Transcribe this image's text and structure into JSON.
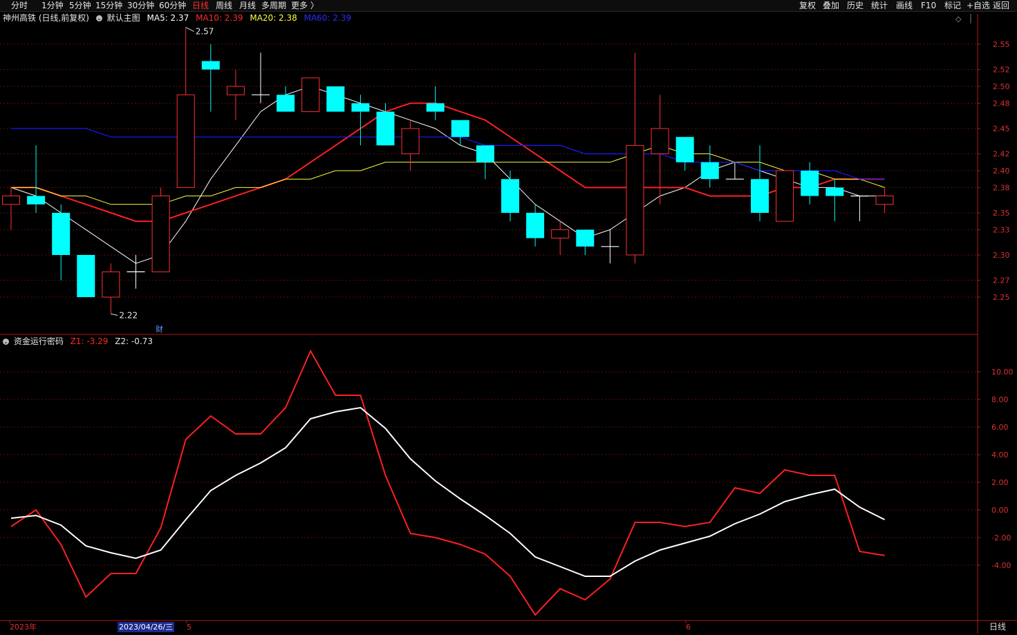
{
  "toolbar": {
    "periods": [
      "分时",
      "1分钟",
      "5分钟",
      "15分钟",
      "30分钟",
      "60分钟",
      "日线",
      "周线",
      "月线",
      "多周期",
      "更多 〉"
    ],
    "active_period": "日线",
    "right_tools": [
      "复权",
      "叠加",
      "历史",
      "统计",
      "画线",
      "F10",
      "标记",
      "+自选",
      "返回"
    ]
  },
  "main_chart": {
    "stock_title": "神州高铁 (日线,前复权)",
    "template": "默认主图",
    "ma5_label": "MA5: 2.37",
    "ma10_label": "MA10: 2.39",
    "ma20_label": "MA20: 2.38",
    "ma60_label": "MA60: 2.39",
    "high_label": "2.57",
    "low_label": "2.22",
    "finance_mark": "财",
    "y_ticks": [
      "2.55",
      "2.52",
      "2.50",
      "2.48",
      "2.45",
      "2.42",
      "2.40",
      "2.38",
      "2.35",
      "2.33",
      "2.30",
      "2.27",
      "2.25"
    ]
  },
  "sub_chart": {
    "indicator": "资金运行密码",
    "z1_label": "Z1: -3.29",
    "z2_label": "Z2: -0.73",
    "y_ticks": [
      "10.00",
      "8.00",
      "6.00",
      "4.00",
      "2.00",
      "0.00",
      "-2.00",
      "-4.00"
    ]
  },
  "axis": {
    "year": "2023年",
    "cursor_date": "2023/04/26/三",
    "month5": "5",
    "month6": "6",
    "period_button": "日线"
  },
  "colors": {
    "up": "#ff3030",
    "down": "#00ffff",
    "ma5": "#ffffff",
    "ma10": "#ff2020",
    "ma20": "#ffff40",
    "ma60": "#1a1aff"
  },
  "chart_data": [
    {
      "type": "candlestick",
      "title": "神州高铁 (日线,前复权)",
      "ylim": [
        2.22,
        2.57
      ],
      "candles": [
        {
          "o": 2.36,
          "h": 2.38,
          "l": 2.33,
          "c": 2.37,
          "color": "up"
        },
        {
          "o": 2.37,
          "h": 2.43,
          "l": 2.35,
          "c": 2.36,
          "color": "down"
        },
        {
          "o": 2.35,
          "h": 2.36,
          "l": 2.27,
          "c": 2.3,
          "color": "down"
        },
        {
          "o": 2.3,
          "h": 2.3,
          "l": 2.25,
          "c": 2.25,
          "color": "down"
        },
        {
          "o": 2.25,
          "h": 2.29,
          "l": 2.23,
          "c": 2.28,
          "color": "up"
        },
        {
          "o": 2.28,
          "h": 2.3,
          "l": 2.26,
          "c": 2.28,
          "color": "doji"
        },
        {
          "o": 2.28,
          "h": 2.38,
          "l": 2.28,
          "c": 2.37,
          "color": "up"
        },
        {
          "o": 2.38,
          "h": 2.57,
          "l": 2.38,
          "c": 2.49,
          "color": "up"
        },
        {
          "o": 2.53,
          "h": 2.55,
          "l": 2.47,
          "c": 2.52,
          "color": "down"
        },
        {
          "o": 2.49,
          "h": 2.52,
          "l": 2.46,
          "c": 2.5,
          "color": "up"
        },
        {
          "o": 2.49,
          "h": 2.54,
          "l": 2.48,
          "c": 2.49,
          "color": "doji"
        },
        {
          "o": 2.49,
          "h": 2.5,
          "l": 2.47,
          "c": 2.47,
          "color": "down"
        },
        {
          "o": 2.47,
          "h": 2.51,
          "l": 2.47,
          "c": 2.51,
          "color": "up"
        },
        {
          "o": 2.5,
          "h": 2.5,
          "l": 2.47,
          "c": 2.47,
          "color": "down"
        },
        {
          "o": 2.48,
          "h": 2.49,
          "l": 2.43,
          "c": 2.47,
          "color": "down"
        },
        {
          "o": 2.47,
          "h": 2.48,
          "l": 2.43,
          "c": 2.43,
          "color": "down"
        },
        {
          "o": 2.42,
          "h": 2.46,
          "l": 2.4,
          "c": 2.45,
          "color": "up"
        },
        {
          "o": 2.48,
          "h": 2.5,
          "l": 2.46,
          "c": 2.47,
          "color": "down"
        },
        {
          "o": 2.46,
          "h": 2.46,
          "l": 2.43,
          "c": 2.44,
          "color": "down"
        },
        {
          "o": 2.43,
          "h": 2.43,
          "l": 2.39,
          "c": 2.41,
          "color": "down"
        },
        {
          "o": 2.39,
          "h": 2.4,
          "l": 2.34,
          "c": 2.35,
          "color": "down"
        },
        {
          "o": 2.35,
          "h": 2.36,
          "l": 2.31,
          "c": 2.32,
          "color": "down"
        },
        {
          "o": 2.32,
          "h": 2.34,
          "l": 2.3,
          "c": 2.33,
          "color": "up"
        },
        {
          "o": 2.33,
          "h": 2.33,
          "l": 2.3,
          "c": 2.31,
          "color": "down"
        },
        {
          "o": 2.31,
          "h": 2.33,
          "l": 2.29,
          "c": 2.31,
          "color": "doji"
        },
        {
          "o": 2.3,
          "h": 2.54,
          "l": 2.29,
          "c": 2.43,
          "color": "up"
        },
        {
          "o": 2.42,
          "h": 2.49,
          "l": 2.36,
          "c": 2.45,
          "color": "up"
        },
        {
          "o": 2.44,
          "h": 2.44,
          "l": 2.4,
          "c": 2.41,
          "color": "down"
        },
        {
          "o": 2.41,
          "h": 2.43,
          "l": 2.38,
          "c": 2.39,
          "color": "down"
        },
        {
          "o": 2.39,
          "h": 2.41,
          "l": 2.39,
          "c": 2.39,
          "color": "doji"
        },
        {
          "o": 2.39,
          "h": 2.43,
          "l": 2.34,
          "c": 2.35,
          "color": "down"
        },
        {
          "o": 2.34,
          "h": 2.4,
          "l": 2.34,
          "c": 2.4,
          "color": "up"
        },
        {
          "o": 2.4,
          "h": 2.41,
          "l": 2.36,
          "c": 2.37,
          "color": "down"
        },
        {
          "o": 2.38,
          "h": 2.39,
          "l": 2.34,
          "c": 2.37,
          "color": "down"
        },
        {
          "o": 2.37,
          "h": 2.37,
          "l": 2.34,
          "c": 2.37,
          "color": "doji"
        },
        {
          "o": 2.36,
          "h": 2.38,
          "l": 2.35,
          "c": 2.37,
          "color": "up"
        }
      ],
      "series": [
        {
          "name": "MA5",
          "values": [
            2.38,
            2.37,
            2.35,
            2.33,
            2.31,
            2.29,
            2.3,
            2.34,
            2.39,
            2.43,
            2.47,
            2.49,
            2.5,
            2.49,
            2.48,
            2.47,
            2.46,
            2.45,
            2.43,
            2.42,
            2.39,
            2.36,
            2.34,
            2.32,
            2.33,
            2.35,
            2.37,
            2.38,
            2.4,
            2.41,
            2.4,
            2.39,
            2.38,
            2.38,
            2.37,
            2.37
          ]
        },
        {
          "name": "MA10",
          "values": [
            2.38,
            2.38,
            2.37,
            2.36,
            2.35,
            2.34,
            2.34,
            2.35,
            2.36,
            2.37,
            2.38,
            2.39,
            2.41,
            2.43,
            2.45,
            2.47,
            2.48,
            2.48,
            2.47,
            2.46,
            2.44,
            2.42,
            2.4,
            2.38,
            2.38,
            2.38,
            2.38,
            2.38,
            2.37,
            2.37,
            2.37,
            2.38,
            2.38,
            2.39,
            2.39,
            2.39
          ]
        },
        {
          "name": "MA20",
          "values": [
            2.38,
            2.38,
            2.37,
            2.37,
            2.36,
            2.36,
            2.36,
            2.37,
            2.37,
            2.38,
            2.38,
            2.39,
            2.39,
            2.4,
            2.4,
            2.41,
            2.41,
            2.41,
            2.41,
            2.41,
            2.41,
            2.41,
            2.41,
            2.41,
            2.41,
            2.42,
            2.43,
            2.42,
            2.42,
            2.41,
            2.41,
            2.4,
            2.4,
            2.39,
            2.39,
            2.38
          ]
        },
        {
          "name": "MA60",
          "values": [
            2.45,
            2.45,
            2.45,
            2.45,
            2.44,
            2.44,
            2.44,
            2.44,
            2.44,
            2.44,
            2.44,
            2.44,
            2.44,
            2.44,
            2.44,
            2.44,
            2.44,
            2.44,
            2.44,
            2.43,
            2.43,
            2.43,
            2.43,
            2.42,
            2.42,
            2.42,
            2.42,
            2.41,
            2.41,
            2.41,
            2.4,
            2.4,
            2.4,
            2.4,
            2.39,
            2.39
          ]
        }
      ]
    },
    {
      "type": "line",
      "title": "资金运行密码",
      "ylim": [
        -7.6,
        11.8
      ],
      "series": [
        {
          "name": "Z1",
          "values": [
            -1.2,
            0.0,
            -2.5,
            -6.3,
            -4.6,
            -4.6,
            -1.3,
            5.1,
            6.8,
            5.5,
            5.5,
            7.4,
            11.5,
            8.3,
            8.3,
            2.5,
            -1.7,
            -2.0,
            -2.5,
            -3.2,
            -4.8,
            -7.6,
            -5.7,
            -6.5,
            -5.0,
            -0.9,
            -0.9,
            -1.2,
            -0.9,
            1.6,
            1.2,
            2.9,
            2.5,
            2.5,
            -3.0,
            -3.3
          ]
        },
        {
          "name": "Z2",
          "values": [
            -0.6,
            -0.4,
            -1.1,
            -2.6,
            -3.1,
            -3.5,
            -2.9,
            -0.7,
            1.4,
            2.5,
            3.4,
            4.5,
            6.6,
            7.1,
            7.4,
            5.9,
            3.7,
            2.1,
            0.8,
            -0.4,
            -1.7,
            -3.4,
            -4.1,
            -4.8,
            -4.8,
            -3.7,
            -2.9,
            -2.4,
            -1.9,
            -1.0,
            -0.3,
            0.6,
            1.1,
            1.5,
            0.2,
            -0.7
          ]
        }
      ]
    }
  ]
}
